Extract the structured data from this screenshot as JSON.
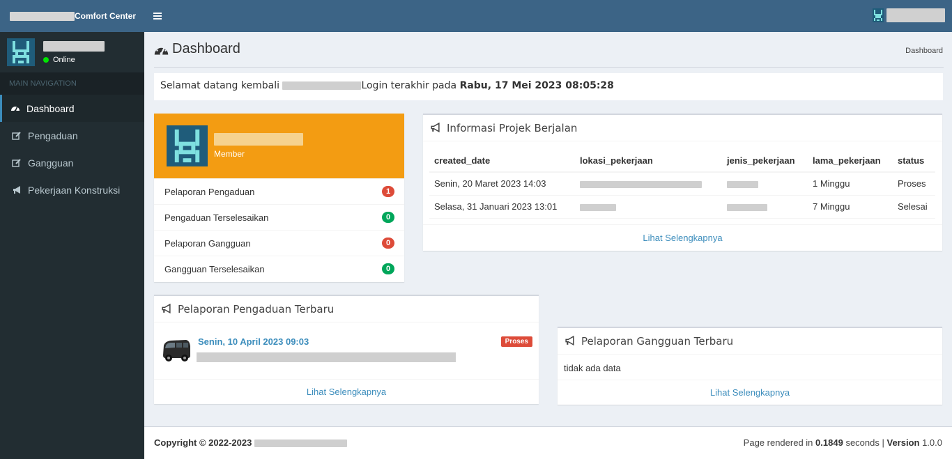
{
  "header": {
    "brand_suffix": "Comfort Center"
  },
  "sidebar": {
    "status": "Online",
    "nav_header": "MAIN NAVIGATION",
    "items": [
      {
        "label": "Dashboard",
        "icon": "dashboard-icon",
        "active": true
      },
      {
        "label": "Pengaduan",
        "icon": "edit-icon"
      },
      {
        "label": "Gangguan",
        "icon": "edit-icon"
      },
      {
        "label": "Pekerjaan Konstruksi",
        "icon": "bullhorn-icon"
      }
    ]
  },
  "page": {
    "title": "Dashboard",
    "breadcrumb": "Dashboard"
  },
  "welcome": {
    "prefix": "Selamat datang kembali",
    "middle": "Login terakhir pada",
    "last_login": "Rabu, 17 Mei 2023 08:05:28"
  },
  "member_widget": {
    "role": "Member",
    "stats": [
      {
        "label": "Pelaporan Pengaduan",
        "count": "1",
        "color": "#dd4b39"
      },
      {
        "label": "Pengaduan Terselesaikan",
        "count": "0",
        "color": "#00a65a"
      },
      {
        "label": "Pelaporan Gangguan",
        "count": "0",
        "color": "#dd4b39"
      },
      {
        "label": "Gangguan Terselesaikan",
        "count": "0",
        "color": "#00a65a"
      }
    ]
  },
  "projek": {
    "title": "Informasi Projek Berjalan",
    "columns": [
      "created_date",
      "lokasi_pekerjaan",
      "jenis_pekerjaan",
      "lama_pekerjaan",
      "status"
    ],
    "rows": [
      {
        "created_date": "Senin, 20 Maret 2023 14:03",
        "lama_pekerjaan": "1 Minggu",
        "status": "Proses"
      },
      {
        "created_date": "Selasa, 31 Januari 2023 13:01",
        "lama_pekerjaan": "7 Minggu",
        "status": "Selesai"
      }
    ],
    "more": "Lihat Selengkapnya"
  },
  "pengaduan_terbaru": {
    "title": "Pelaporan Pengaduan Terbaru",
    "item_date": "Senin, 10 April 2023 09:03",
    "item_status": "Proses",
    "more": "Lihat Selengkapnya"
  },
  "gangguan_terbaru": {
    "title": "Pelaporan Gangguan Terbaru",
    "empty": "tidak ada data",
    "more": "Lihat Selengkapnya"
  },
  "footer": {
    "copyright": "Copyright © 2022-2023",
    "rendered_prefix": "Page rendered in",
    "rendered_time": "0.1849",
    "rendered_suffix": "seconds |",
    "version_label": "Version",
    "version": "1.0.0"
  },
  "colors": {
    "header": "#3c6486",
    "sidebar": "#222d32",
    "accent": "#3c8dbc",
    "widget": "#f39c12"
  }
}
